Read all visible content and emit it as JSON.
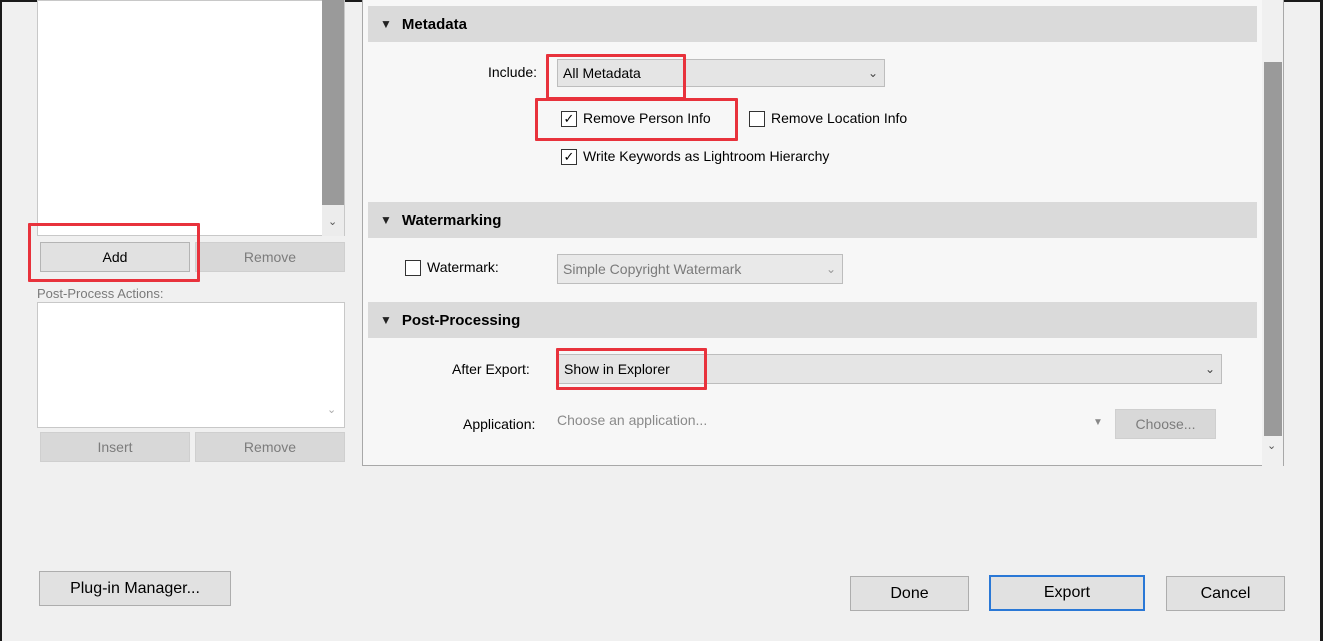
{
  "left": {
    "add_label": "Add",
    "remove_label": "Remove",
    "post_process_label": "Post-Process Actions:",
    "insert_label": "Insert",
    "remove2_label": "Remove"
  },
  "metadata": {
    "header": "Metadata",
    "include_label": "Include:",
    "include_value": "All Metadata",
    "remove_person_label": "Remove Person Info",
    "remove_person_checked": true,
    "remove_location_label": "Remove Location Info",
    "remove_location_checked": false,
    "write_keywords_label": "Write Keywords as Lightroom Hierarchy",
    "write_keywords_checked": true
  },
  "watermarking": {
    "header": "Watermarking",
    "watermark_label": "Watermark:",
    "watermark_checked": false,
    "watermark_value": "Simple Copyright Watermark"
  },
  "post_processing": {
    "header": "Post-Processing",
    "after_export_label": "After Export:",
    "after_export_value": "Show in Explorer",
    "application_label": "Application:",
    "application_placeholder": "Choose an application...",
    "choose_label": "Choose..."
  },
  "footer": {
    "plugin_manager_label": "Plug-in Manager...",
    "done_label": "Done",
    "export_label": "Export",
    "cancel_label": "Cancel"
  },
  "colors": {
    "highlight": "#e8323c",
    "export_border": "#2a78d6"
  },
  "icons": {
    "checkmark": "✓",
    "triangle": "▼",
    "chevron": "⌄"
  }
}
